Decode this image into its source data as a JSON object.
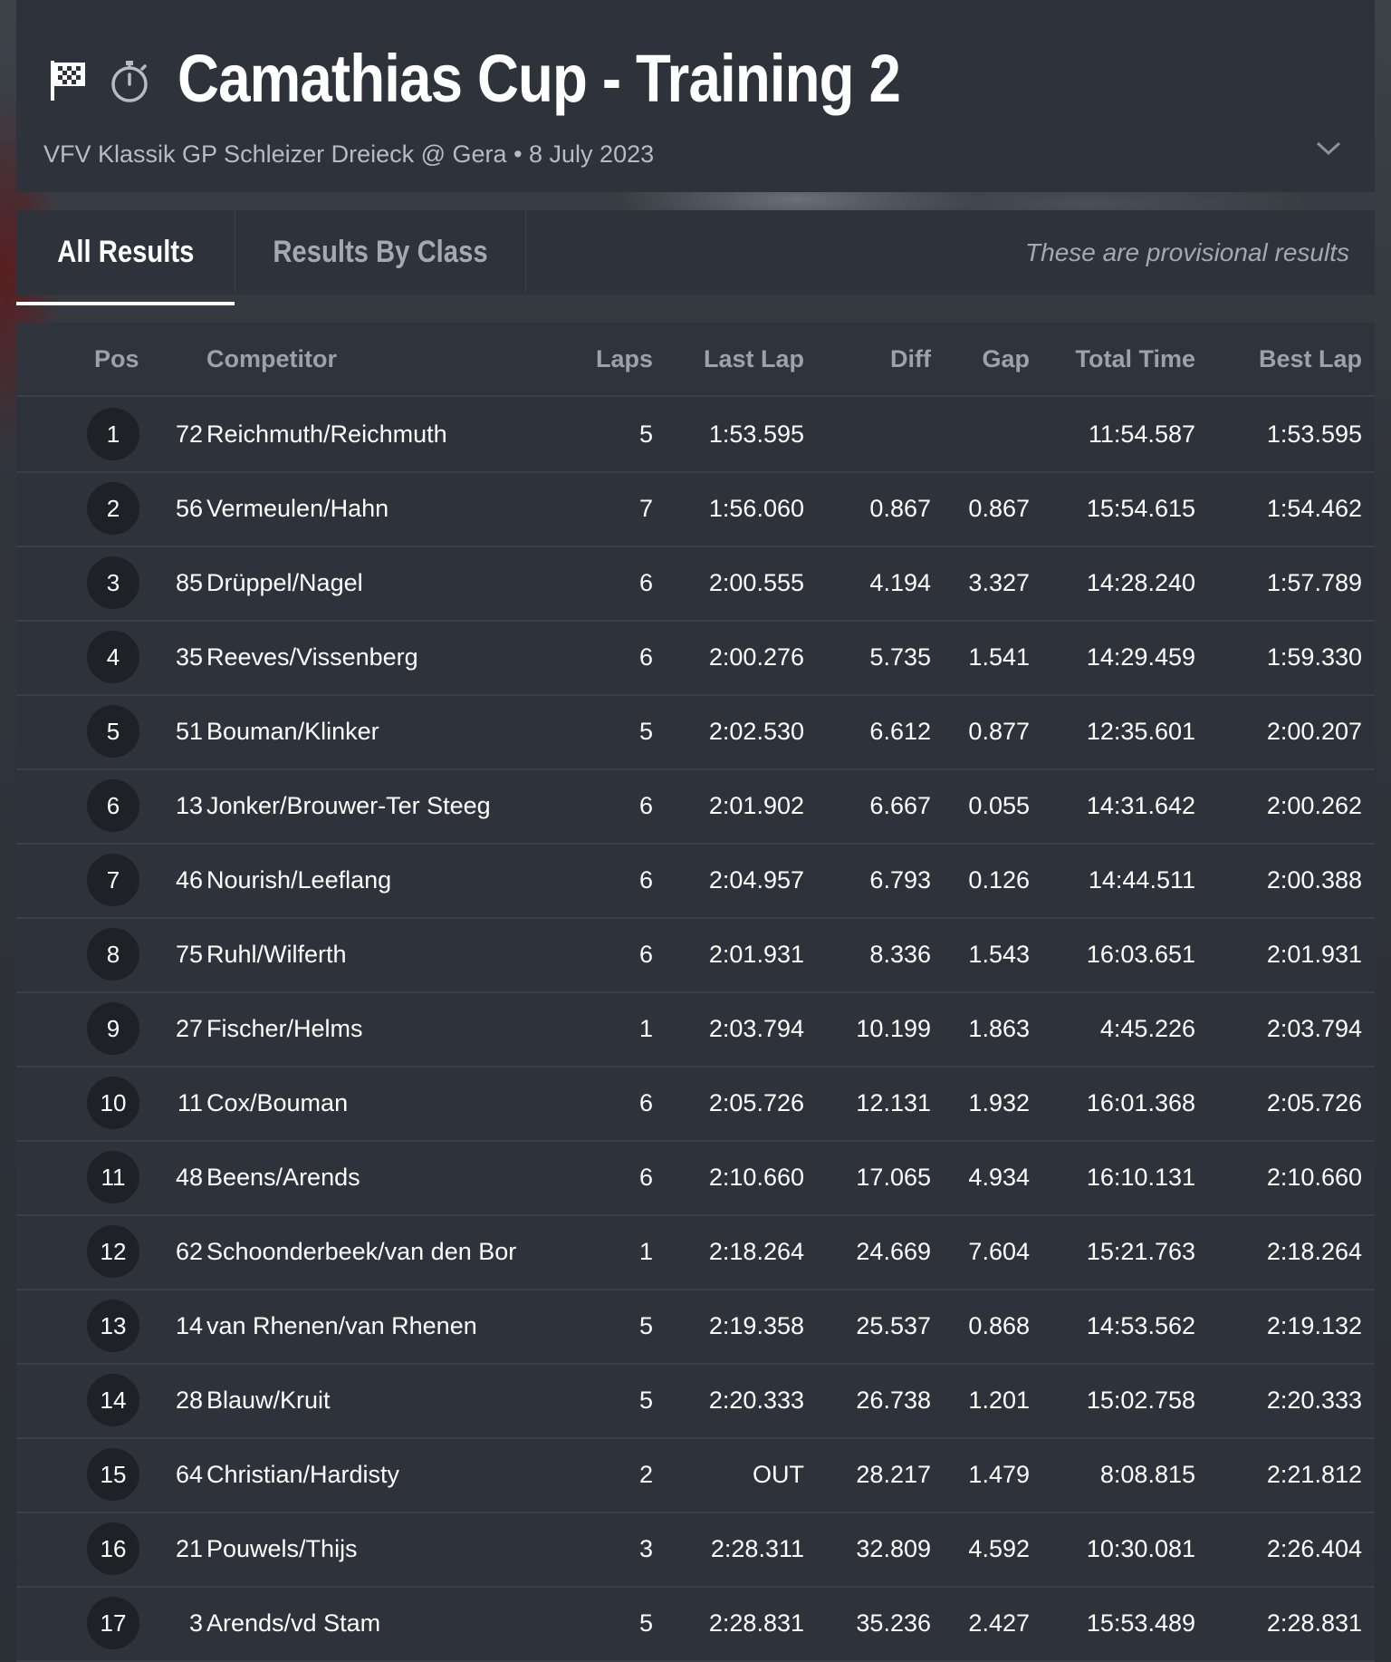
{
  "header": {
    "title": "Camathias Cup - Training 2",
    "subtitle": "VFV Klassik GP Schleizer Dreieck @ Gera • 8 July 2023"
  },
  "tabs": [
    {
      "label": "All Results",
      "active": true
    },
    {
      "label": "Results By Class",
      "active": false
    }
  ],
  "notice": "These are provisional results",
  "columns": {
    "pos": "Pos",
    "competitor": "Competitor",
    "laps": "Laps",
    "last_lap": "Last Lap",
    "diff": "Diff",
    "gap": "Gap",
    "total_time": "Total Time",
    "best_lap": "Best Lap"
  },
  "rows": [
    {
      "pos": "1",
      "num": "72",
      "name": "Reichmuth/Reichmuth",
      "laps": "5",
      "last": "1:53.595",
      "diff": "",
      "gap": "",
      "total": "11:54.587",
      "best": "1:53.595"
    },
    {
      "pos": "2",
      "num": "56",
      "name": "Vermeulen/Hahn",
      "laps": "7",
      "last": "1:56.060",
      "diff": "0.867",
      "gap": "0.867",
      "total": "15:54.615",
      "best": "1:54.462"
    },
    {
      "pos": "3",
      "num": "85",
      "name": "Drüppel/Nagel",
      "laps": "6",
      "last": "2:00.555",
      "diff": "4.194",
      "gap": "3.327",
      "total": "14:28.240",
      "best": "1:57.789"
    },
    {
      "pos": "4",
      "num": "35",
      "name": "Reeves/Vissenberg",
      "laps": "6",
      "last": "2:00.276",
      "diff": "5.735",
      "gap": "1.541",
      "total": "14:29.459",
      "best": "1:59.330"
    },
    {
      "pos": "5",
      "num": "51",
      "name": "Bouman/Klinker",
      "laps": "5",
      "last": "2:02.530",
      "diff": "6.612",
      "gap": "0.877",
      "total": "12:35.601",
      "best": "2:00.207"
    },
    {
      "pos": "6",
      "num": "13",
      "name": "Jonker/Brouwer-Ter Steeg",
      "laps": "6",
      "last": "2:01.902",
      "diff": "6.667",
      "gap": "0.055",
      "total": "14:31.642",
      "best": "2:00.262"
    },
    {
      "pos": "7",
      "num": "46",
      "name": "Nourish/Leeflang",
      "laps": "6",
      "last": "2:04.957",
      "diff": "6.793",
      "gap": "0.126",
      "total": "14:44.511",
      "best": "2:00.388"
    },
    {
      "pos": "8",
      "num": "75",
      "name": "Ruhl/Wilferth",
      "laps": "6",
      "last": "2:01.931",
      "diff": "8.336",
      "gap": "1.543",
      "total": "16:03.651",
      "best": "2:01.931"
    },
    {
      "pos": "9",
      "num": "27",
      "name": "Fischer/Helms",
      "laps": "1",
      "last": "2:03.794",
      "diff": "10.199",
      "gap": "1.863",
      "total": "4:45.226",
      "best": "2:03.794"
    },
    {
      "pos": "10",
      "num": "11",
      "name": "Cox/Bouman",
      "laps": "6",
      "last": "2:05.726",
      "diff": "12.131",
      "gap": "1.932",
      "total": "16:01.368",
      "best": "2:05.726"
    },
    {
      "pos": "11",
      "num": "48",
      "name": "Beens/Arends",
      "laps": "6",
      "last": "2:10.660",
      "diff": "17.065",
      "gap": "4.934",
      "total": "16:10.131",
      "best": "2:10.660"
    },
    {
      "pos": "12",
      "num": "62",
      "name": "Schoonderbeek/van den Bor",
      "laps": "1",
      "last": "2:18.264",
      "diff": "24.669",
      "gap": "7.604",
      "total": "15:21.763",
      "best": "2:18.264"
    },
    {
      "pos": "13",
      "num": "14",
      "name": "van Rhenen/van Rhenen",
      "laps": "5",
      "last": "2:19.358",
      "diff": "25.537",
      "gap": "0.868",
      "total": "14:53.562",
      "best": "2:19.132"
    },
    {
      "pos": "14",
      "num": "28",
      "name": "Blauw/Kruit",
      "laps": "5",
      "last": "2:20.333",
      "diff": "26.738",
      "gap": "1.201",
      "total": "15:02.758",
      "best": "2:20.333"
    },
    {
      "pos": "15",
      "num": "64",
      "name": "Christian/Hardisty",
      "laps": "2",
      "last": "OUT",
      "diff": "28.217",
      "gap": "1.479",
      "total": "8:08.815",
      "best": "2:21.812"
    },
    {
      "pos": "16",
      "num": "21",
      "name": "Pouwels/Thijs",
      "laps": "3",
      "last": "2:28.311",
      "diff": "32.809",
      "gap": "4.592",
      "total": "10:30.081",
      "best": "2:26.404"
    },
    {
      "pos": "17",
      "num": "3",
      "name": "Arends/vd Stam",
      "laps": "5",
      "last": "2:28.831",
      "diff": "35.236",
      "gap": "2.427",
      "total": "15:53.489",
      "best": "2:28.831"
    }
  ],
  "icons": {
    "flag": "checkered-flag-icon",
    "timer": "stopwatch-icon",
    "expand": "chevron-down-icon"
  },
  "colors": {
    "background": "#2e323a",
    "text": "#ffffff",
    "muted": "#a3a9b2",
    "pos_circle": "#1e2126"
  }
}
